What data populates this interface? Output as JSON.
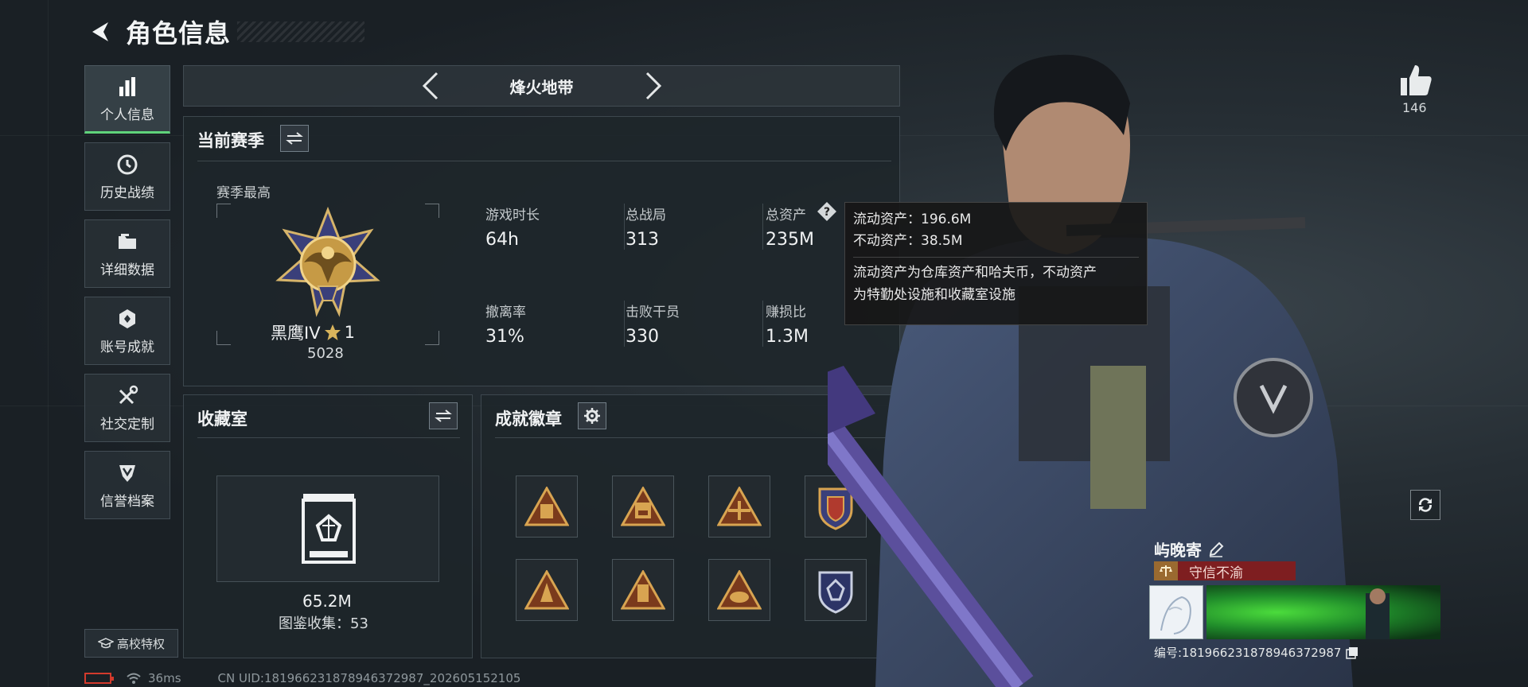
{
  "header": {
    "title": "角色信息"
  },
  "sidebar": {
    "items": [
      {
        "label": "个人信息",
        "icon": "bar-chart-icon",
        "active": true
      },
      {
        "label": "历史战绩",
        "icon": "history-clock-icon"
      },
      {
        "label": "详细数据",
        "icon": "folder-icon"
      },
      {
        "label": "账号成就",
        "icon": "achievement-icon"
      },
      {
        "label": "社交定制",
        "icon": "tools-icon"
      },
      {
        "label": "信誉档案",
        "icon": "credit-shield-icon"
      }
    ],
    "campus_label": "高校特权"
  },
  "mode": {
    "name": "烽火地带"
  },
  "season": {
    "title": "当前赛季",
    "subtitle": "赛季最高",
    "rank_name": "黑鹰IV",
    "rank_stars": "1",
    "rank_score": "5028",
    "stats": [
      {
        "label": "游戏时长",
        "value": "64h"
      },
      {
        "label": "总战局",
        "value": "313"
      },
      {
        "label": "总资产",
        "value": "235M"
      },
      {
        "label": "撤离率",
        "value": "31%"
      },
      {
        "label": "击败干员",
        "value": "330"
      },
      {
        "label": "赚损比",
        "value": "1.3M"
      }
    ]
  },
  "tooltip": {
    "line1": "流动资产：196.6M",
    "line2": "不动资产：38.5M",
    "desc1": "流动资产为仓库资产和哈夫币，不动资产",
    "desc2": "为特勤处设施和收藏室设施"
  },
  "collection": {
    "title": "收藏室",
    "value": "65.2M",
    "count_label": "图鉴收集：53"
  },
  "badges": {
    "title": "成就徽章"
  },
  "profile": {
    "likes": "146",
    "name": "屿晚寄",
    "title_tag": "守信不渝",
    "uid_label": "编号:1819662318789463729​87"
  },
  "footer": {
    "ping": "36ms",
    "uid_line": "CN UID:1819662318789463729​87_202605152105"
  },
  "colors": {
    "accent": "#5fd37a",
    "tag_red": "#7e1e20",
    "battery": "#d33a2c"
  }
}
